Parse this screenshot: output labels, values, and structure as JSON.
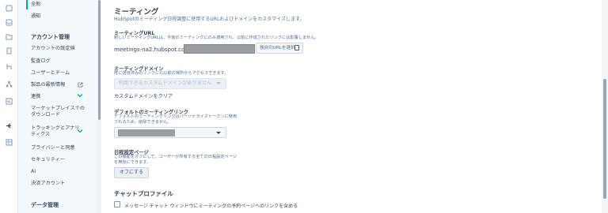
{
  "rail": {
    "icons": [
      "contacts-icon",
      "inbox-icon",
      "folder-icon",
      "book-icon",
      "automation-icon",
      "reports-icon",
      "collapse-icon",
      "table-icon"
    ]
  },
  "sidebar": {
    "top_items": [
      {
        "label": "全般",
        "active": true
      },
      {
        "label": "通知"
      }
    ],
    "account_section": {
      "title": "アカウント管理",
      "items": [
        {
          "label": "アカウントの既定値"
        },
        {
          "label": "監査ログ"
        },
        {
          "label": "ユーザーとチーム"
        },
        {
          "label": "製品の最新情報",
          "external": true
        },
        {
          "label": "連携",
          "expandable": true
        },
        {
          "label": "マーケットプレイスでの\nダウンロード"
        },
        {
          "label": "トラッキングとアナリ\nティクス",
          "expandable": true
        },
        {
          "label": "プライバシーと同意"
        },
        {
          "label": "セキュリティー"
        },
        {
          "label": "AI"
        },
        {
          "label": "決済アカウント"
        }
      ]
    },
    "data_section": {
      "title": "データ管理"
    }
  },
  "main": {
    "title": "ミーティング",
    "description": "HubSpotのミーティング日程調整に使用するURLおよびドメインをカスタマイズします。",
    "meeting_url": {
      "label": "ミーティングURL",
      "help": "新しいミーティングURLは、今後のミーティングにのみ適用され、以前に作成されたリンクには影響しません。",
      "prefix": "meetings-na2.hubspot.com/",
      "button_label": "独自のURLを選択"
    },
    "meeting_domain": {
      "label": "ミーティングドメイン",
      "help": "既に送信済みのリンクにも以前の場所からアクセスできます。",
      "select_placeholder": "利用できるカスタムドメインがありません",
      "clear_link": "カスタムドメインをクリア"
    },
    "default_link": {
      "label": "デフォルトのミーティングリンク",
      "help": "デフォルトのミーティングリンクはパーソナライズトークンに使用\nされるため、削除できません。"
    },
    "scheduling_page": {
      "label": "日程設定ページ",
      "help": "この機能をオフにして、ユーザーが所有する全ての日程設定ページ\nを無効にできます。",
      "button_label": "オフにする"
    },
    "chat_profile": {
      "title": "チャットプロファイル",
      "checkbox_label": "メッセージ チャット ウィンドウにミーティングの予約ページへのリンクを含める",
      "checked": false
    }
  }
}
